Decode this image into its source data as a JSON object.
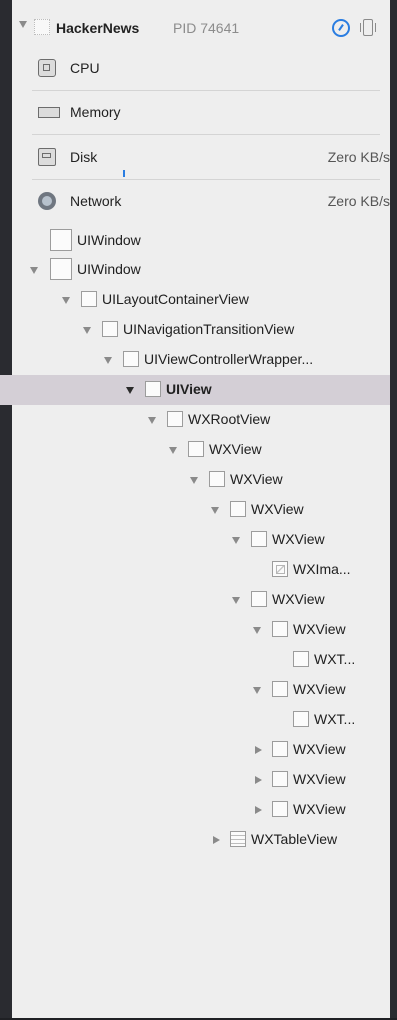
{
  "header": {
    "app_name": "HackerNews",
    "pid": "PID 74641",
    "accent": "#2a7de1"
  },
  "gauges": [
    {
      "label": "CPU",
      "value": "",
      "icon": "cpu-icon"
    },
    {
      "label": "Memory",
      "value": "",
      "icon": "memory-icon"
    },
    {
      "label": "Disk",
      "value": "Zero KB/s",
      "icon": "disk-icon"
    },
    {
      "label": "Network",
      "value": "Zero KB/s",
      "icon": "network-icon"
    }
  ],
  "tree": [
    {
      "label": "UIWindow",
      "disclosure": "none",
      "icon": "view-icon"
    },
    {
      "label": "UIWindow",
      "disclosure": "expanded",
      "icon": "view-icon"
    },
    {
      "label": "UILayoutContainerView",
      "disclosure": "expanded",
      "icon": "view-icon"
    },
    {
      "label": "UINavigationTransitionView",
      "disclosure": "expanded",
      "icon": "view-icon"
    },
    {
      "label": "UIViewControllerWrapper...",
      "disclosure": "expanded",
      "icon": "view-icon"
    },
    {
      "label": "UIView",
      "disclosure": "expanded",
      "icon": "view-icon",
      "selected": true
    },
    {
      "label": "WXRootView",
      "disclosure": "expanded",
      "icon": "view-icon"
    },
    {
      "label": "WXView",
      "disclosure": "expanded",
      "icon": "view-icon"
    },
    {
      "label": "WXView",
      "disclosure": "expanded",
      "icon": "view-icon"
    },
    {
      "label": "WXView",
      "disclosure": "expanded",
      "icon": "view-icon"
    },
    {
      "label": "WXView",
      "disclosure": "expanded",
      "icon": "view-icon"
    },
    {
      "label": "WXIma...",
      "disclosure": "none",
      "icon": "image-view-icon"
    },
    {
      "label": "WXView",
      "disclosure": "expanded",
      "icon": "view-icon"
    },
    {
      "label": "WXView",
      "disclosure": "expanded",
      "icon": "view-icon"
    },
    {
      "label": "WXT...",
      "disclosure": "none",
      "icon": "view-icon"
    },
    {
      "label": "WXView",
      "disclosure": "expanded",
      "icon": "view-icon"
    },
    {
      "label": "WXT...",
      "disclosure": "none",
      "icon": "view-icon"
    },
    {
      "label": "WXView",
      "disclosure": "collapsed",
      "icon": "view-icon"
    },
    {
      "label": "WXView",
      "disclosure": "collapsed",
      "icon": "view-icon"
    },
    {
      "label": "WXView",
      "disclosure": "collapsed",
      "icon": "view-icon"
    },
    {
      "label": "WXTableView",
      "disclosure": "collapsed",
      "icon": "table-view-icon"
    }
  ]
}
